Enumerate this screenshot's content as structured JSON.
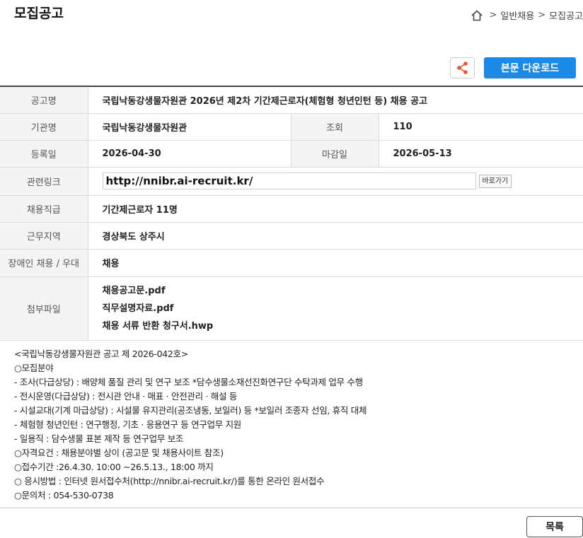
{
  "header": {
    "page_title": "모집공고",
    "breadcrumb": [
      "일반채용",
      "모집공고"
    ],
    "breadcrumb_sep": ">"
  },
  "toolbar": {
    "download_label": "본문 다운로드",
    "accent_color": "#1a8ae6"
  },
  "info": {
    "title_label": "공고명",
    "title_value": "국립낙동강생물자원관 2026년 제2차 기간제근로자(체험형 청년인턴 등) 채용 공고",
    "org_label": "기관명",
    "org_value": "국립낙동강생물자원관",
    "views_label": "조회",
    "views_value": "110",
    "reg_label": "등록일",
    "reg_value": "2026-04-30",
    "deadline_label": "마감일",
    "deadline_value": "2026-05-13",
    "link_label": "관련링크",
    "link_value": "http://nnibr.ai-recruit.kr/",
    "go_label": "바로가기",
    "position_label": "채용직급",
    "position_value": "기간제근로자 11명",
    "region_label": "근무지역",
    "region_value": "경상북도 상주시",
    "disabled_label": "장애인 채용 / 우대",
    "disabled_value": "채용",
    "files_label": "첨부파일",
    "files": [
      "채용공고문.pdf",
      "직무설명자료.pdf",
      "채용 서류 반환 청구서.hwp"
    ]
  },
  "body_lines": [
    "<국립낙동강생물자원관 공고 제 2026-042호>",
    " ○모집분야",
    " - 조사(다급상당) : 배양체 품질 관리 및 연구 보조 *담수생물소재선진화연구단 수탁과제 업무 수행",
    " - 전시운영(다급상당) : 전시관 안내 · 매표 · 안전관리 · 해설 등",
    " - 시설교대(기계 마급상당) : 시설물 유지관리(공조냉동, 보일러) 등 *보일러 조종자 선임, 휴직 대체",
    " - 체험형 청년인턴 : 연구행정, 기초 · 응용연구 등 연구업무 지원",
    " - 일용직 : 담수생물 표본 제작 등 연구업무 보조",
    "○자격요건 : 채용분야별 상이 (공고문 및 채용사이트 참조)",
    "○접수기간 :26.4.30. 10:00 ~26.5.13., 18:00 까지",
    "○ 응시방법 : 인터넷 원서접수처(http://nnibr.ai-recruit.kr/)를 통한 온라인 원서접수",
    "○문의처 : 054-530-0738"
  ],
  "footer": {
    "list_label": "목록"
  }
}
